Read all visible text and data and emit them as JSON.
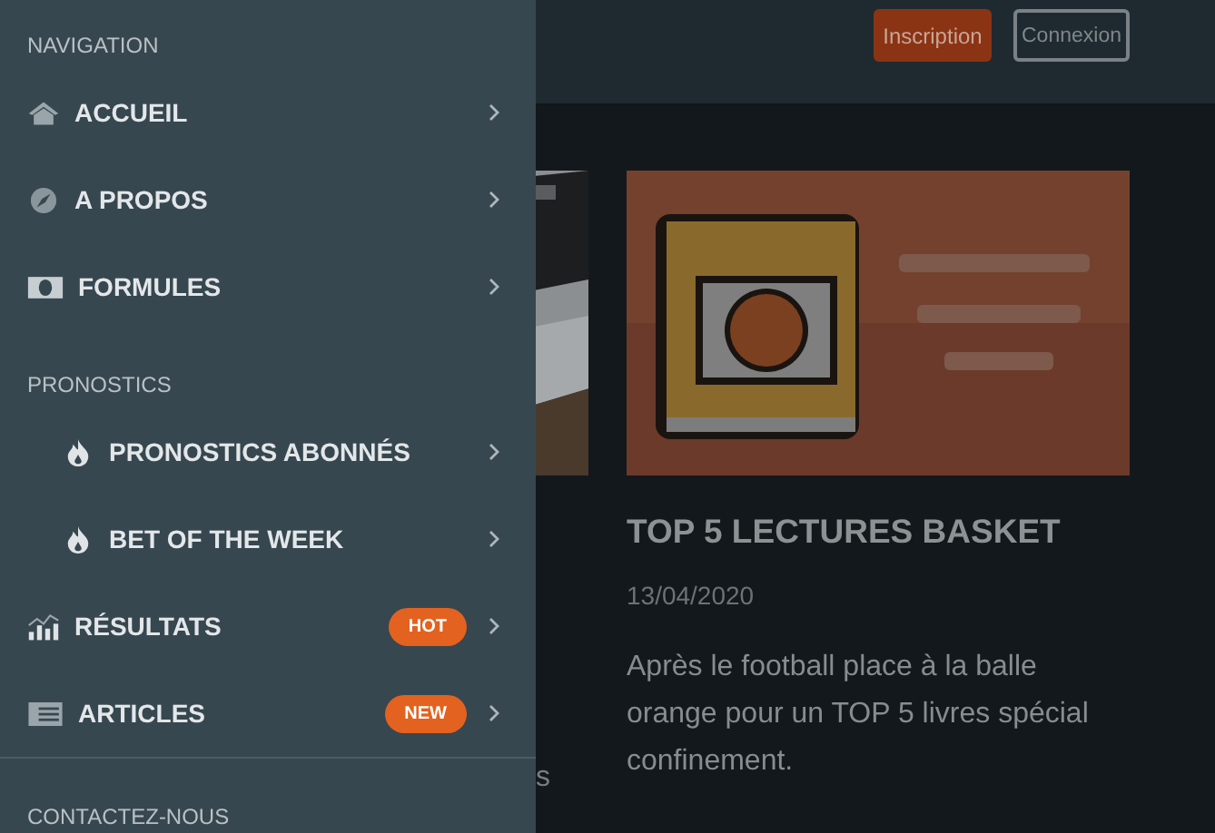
{
  "header": {
    "buttons": [
      {
        "label": "Inscription",
        "kind": "primary"
      },
      {
        "label": "Connexion",
        "kind": "outline"
      }
    ]
  },
  "left_article": {
    "text_fragment": "s"
  },
  "article": {
    "title": "TOP 5 LECTURES BASKET",
    "date": "13/04/2020",
    "excerpt": "Après le football place à la balle orange pour un TOP 5 livres spécial confinement."
  },
  "drawer": {
    "sections": [
      {
        "title": "NAVIGATION",
        "items": [
          {
            "label": "ACCUEIL",
            "kind": "top"
          },
          {
            "label": "A PROPOS",
            "kind": "top"
          },
          {
            "label": "FORMULES",
            "kind": "top"
          }
        ]
      },
      {
        "title": "PRONOSTICS",
        "items": [
          {
            "label": "PRONOSTICS ABONNÉS",
            "kind": "sub"
          },
          {
            "label": "BET OF THE WEEK",
            "kind": "sub"
          },
          {
            "label": "RÉSULTATS",
            "kind": "top",
            "badge": "HOT"
          },
          {
            "label": "ARTICLES",
            "kind": "top",
            "badge": "NEW"
          }
        ]
      },
      {
        "title": "CONTACTEZ-NOUS"
      }
    ]
  }
}
